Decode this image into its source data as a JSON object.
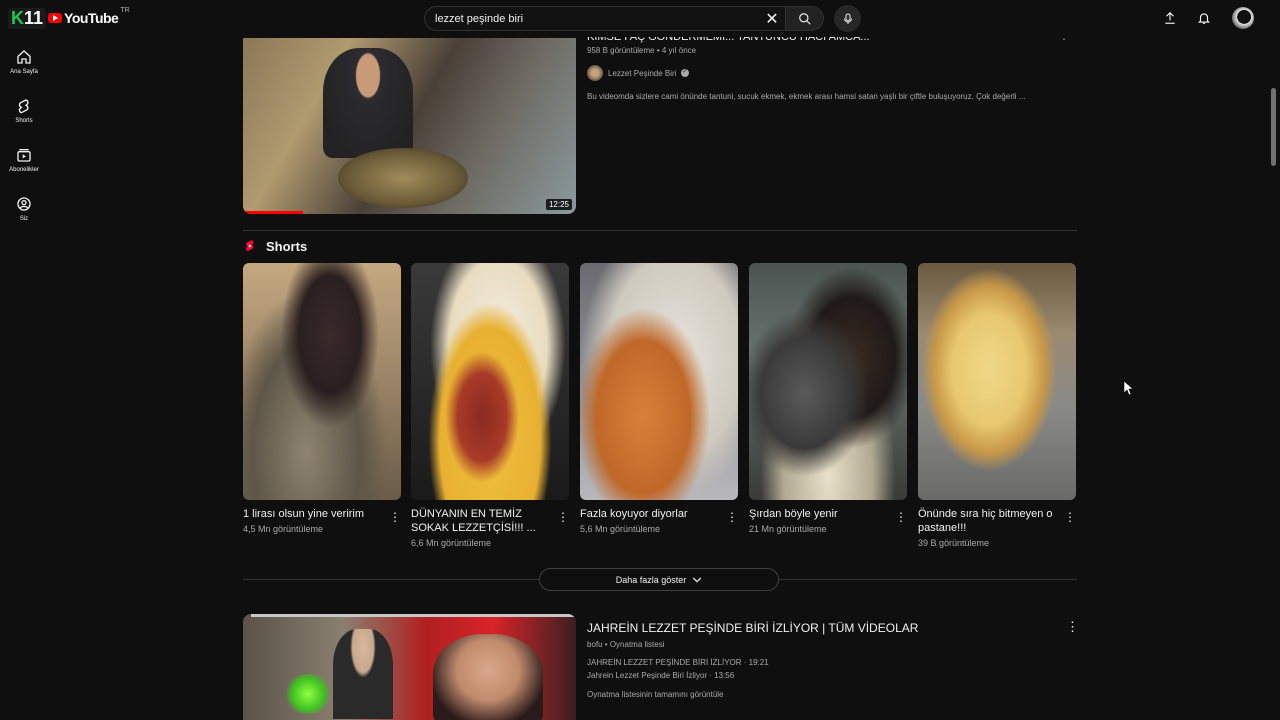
{
  "header": {
    "logo_badge": "11",
    "logo_word": "YouTube",
    "country": "TR",
    "search_query": "lezzet peşinde biri"
  },
  "sidebar": {
    "items": [
      {
        "label": "Ana Sayfa",
        "icon": "home-icon"
      },
      {
        "label": "Shorts",
        "icon": "shorts-icon"
      },
      {
        "label": "Abonelikler",
        "icon": "subscriptions-icon"
      },
      {
        "label": "Siz",
        "icon": "you-icon"
      }
    ]
  },
  "video1": {
    "title": "KIMSE I AÇ GÖNDERMEMI... TANTUNCU HACI AMCA...",
    "meta": "958 B görüntüleme • 4 yıl önce",
    "channel": "Lezzet Peşinde Biri",
    "description": "Bu videomda sizlere cami önünde tantuni, sucuk ekmek, ekmek arası hamsi satan yaşlı bir çiftle buluşuyoruz. Çok değerli ...",
    "duration": "12:25"
  },
  "shorts": {
    "heading": "Shorts",
    "items": [
      {
        "title": "1 lirası olsun yine veririm",
        "views": "4,5 Mn görüntüleme"
      },
      {
        "title": "DÜNYANIN EN TEMİZ SOKAK LEZZETÇİSİ!!! ...",
        "views": "6,6 Mn görüntüleme"
      },
      {
        "title": "Fazla koyuyor diyorlar",
        "views": "5,6 Mn görüntüleme"
      },
      {
        "title": "Şırdan böyle yenir",
        "views": "21 Mn görüntüleme"
      },
      {
        "title": "Önünde sıra hiç bitmeyen o pastane!!!",
        "views": "39 B görüntüleme"
      }
    ],
    "show_more": "Daha fazla göster"
  },
  "playlist": {
    "title": "JAHREİN LEZZET PEŞİNDE BİRİ İZLİYOR | TÜM VİDEOLAR",
    "subtitle": "bofu • Oynatma listesi",
    "line1": "JAHREİN LEZZET PEŞİNDE BİRİ İZLİYOR · 19:21",
    "line2": "Jahrein Lezzet Peşinde Biri İzliyor · 13:56",
    "view_all": "Oynatma listesinin tamamını görüntüle"
  }
}
